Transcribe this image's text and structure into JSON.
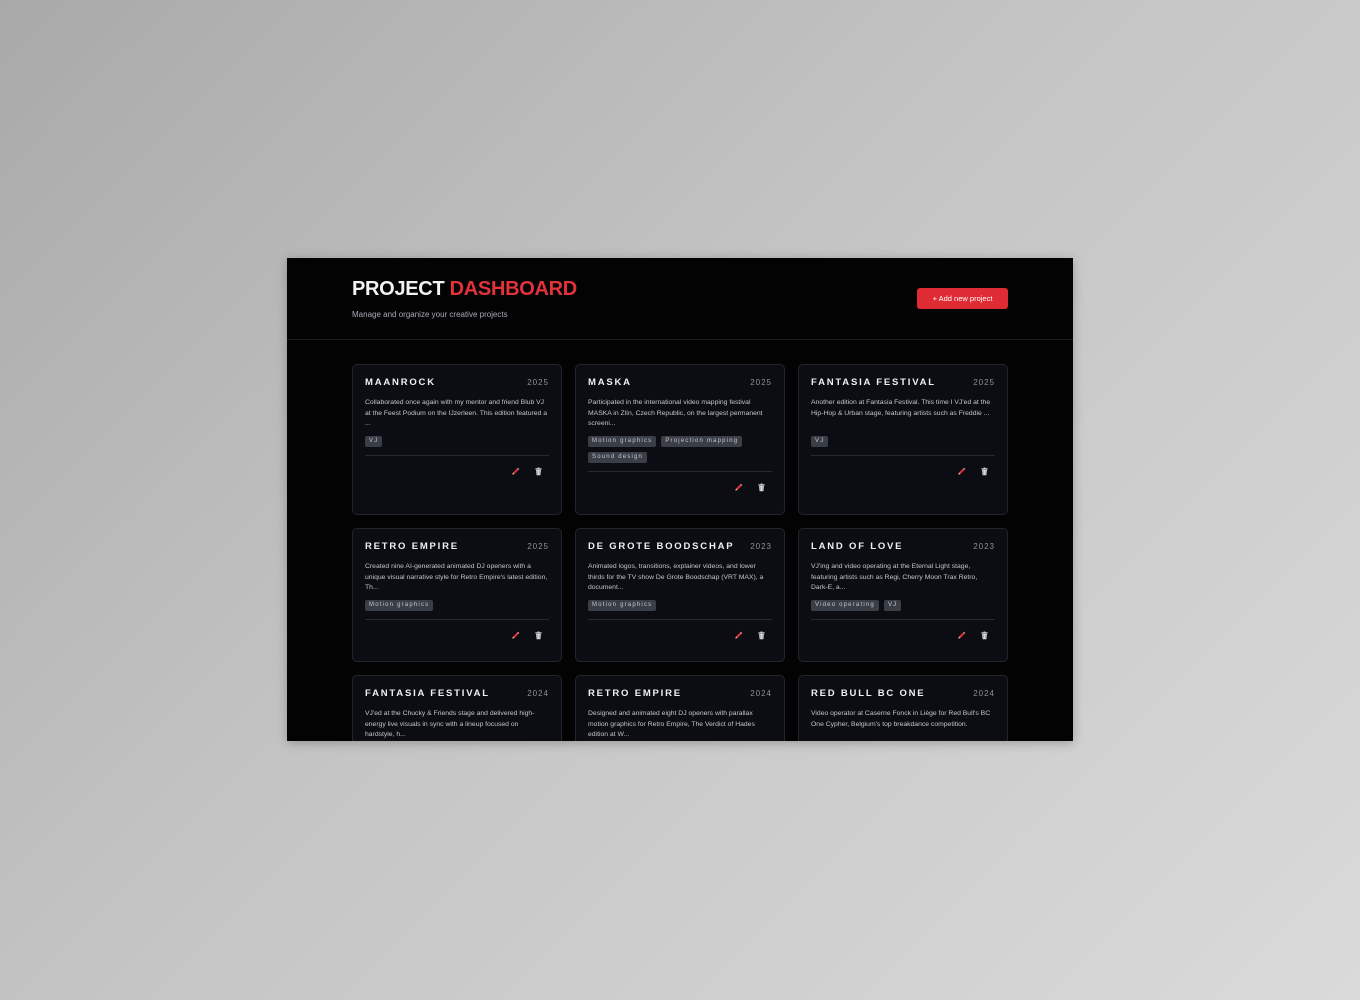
{
  "header": {
    "title_main": "PROJECT",
    "title_accent": "DASHBOARD",
    "subtitle": "Manage and organize your creative projects",
    "add_button": "+ Add new project"
  },
  "colors": {
    "accent": "#e2323a",
    "background": "#030304",
    "card": "#0b0d13",
    "tag": "#3a3e47"
  },
  "projects": [
    {
      "title": "MAANROCK",
      "year": "2025",
      "description": "Collaborated once again with my mentor and friend Blub VJ at the Feest Podium on the IJzerleen. This edition featured a ...",
      "tags": [
        "VJ"
      ]
    },
    {
      "title": "MASKA",
      "year": "2025",
      "description": "Participated in the international video mapping festival MASKA in Zlín, Czech Republic, on the largest permanent screeni...",
      "tags": [
        "Motion graphics",
        "Projection mapping",
        "Sound design"
      ]
    },
    {
      "title": "FANTASIA FESTIVAL",
      "year": "2025",
      "description": "Another edition at Fantasia Festival. This time I VJ'ed at the Hip-Hop & Urban stage, featuring artists such as Freddie ...",
      "tags": [
        "VJ"
      ]
    },
    {
      "title": "RETRO EMPIRE",
      "year": "2025",
      "description": "Created nine AI-generated animated DJ openers with a unique visual narrative style for Retro Empire's latest edition, Th...",
      "tags": [
        "Motion graphics"
      ]
    },
    {
      "title": "DE GROTE BOODSCHAP",
      "year": "2023",
      "description": "Animated logos, transitions, explainer videos, and lower thirds for the TV show De Grote Boodschap (VRT MAX), a document...",
      "tags": [
        "Motion graphics"
      ]
    },
    {
      "title": "LAND OF LOVE",
      "year": "2023",
      "description": "VJ'ing and video operating at the Eternal Light stage, featuring artists such as Regi, Cherry Moon Trax Retro, Dark-E, a...",
      "tags": [
        "Video operating",
        "VJ"
      ]
    },
    {
      "title": "FANTASIA FESTIVAL",
      "year": "2024",
      "description": "VJ'ed at the Chucky & Friends stage and delivered high-energy live visuals in sync with a lineup focused on hardstyle, h...",
      "tags": []
    },
    {
      "title": "RETRO EMPIRE",
      "year": "2024",
      "description": "Designed and animated eight DJ openers with parallax motion graphics for Retro Empire, The Verdict of Hades edition at W...",
      "tags": []
    },
    {
      "title": "RED BULL BC ONE",
      "year": "2024",
      "description": "Video operator at Caserne Fonck in Liège for Red Bull's BC One Cypher, Belgium's top breakdance competition.",
      "tags": []
    }
  ],
  "icons": {
    "edit": "pencil-icon",
    "delete": "trash-icon"
  }
}
